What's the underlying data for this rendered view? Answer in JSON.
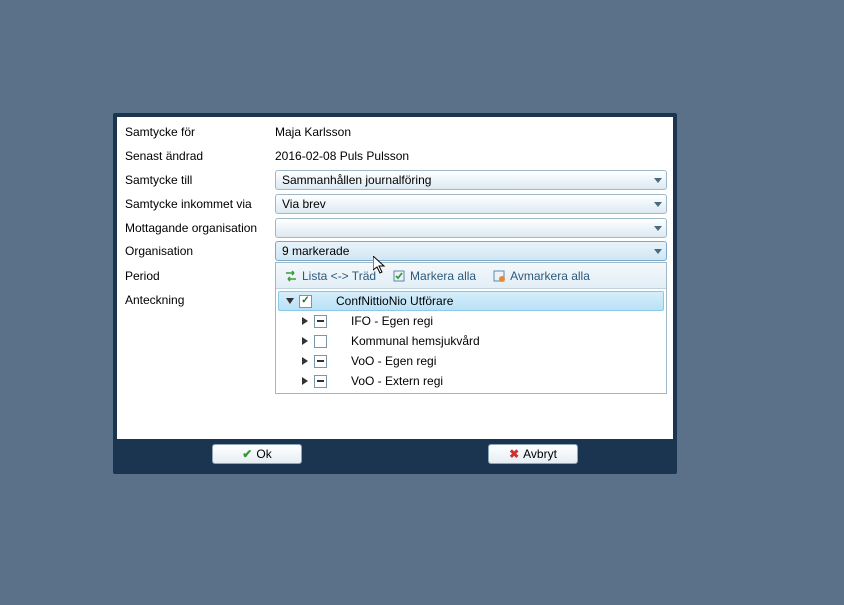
{
  "labels": {
    "samtycke_for": "Samtycke för",
    "senast_andrad": "Senast ändrad",
    "samtycke_till": "Samtycke till",
    "samtycke_inkommet_via": "Samtycke inkommet via",
    "mottagande_org": "Mottagande organisation",
    "organisation": "Organisation",
    "period": "Period",
    "anteckning": "Anteckning"
  },
  "values": {
    "samtycke_for": "Maja Karlsson",
    "senast_andrad": "2016-02-08 Puls Pulsson",
    "samtycke_till": "Sammanhållen journalföring",
    "samtycke_inkommet_via": "Via brev",
    "mottagande_org": "",
    "organisation": "9 markerade"
  },
  "dropdown": {
    "lista_trad": "Lista <-> Träd",
    "markera_alla": "Markera alla",
    "avmarkera_alla": "Avmarkera alla",
    "tree": {
      "root": "ConfNittioNio Utförare",
      "children": [
        "IFO - Egen regi",
        "Kommunal hemsjukvård",
        "VoO - Egen regi",
        "VoO - Extern regi"
      ]
    }
  },
  "buttons": {
    "ok": "Ok",
    "avbryt": "Avbryt"
  }
}
